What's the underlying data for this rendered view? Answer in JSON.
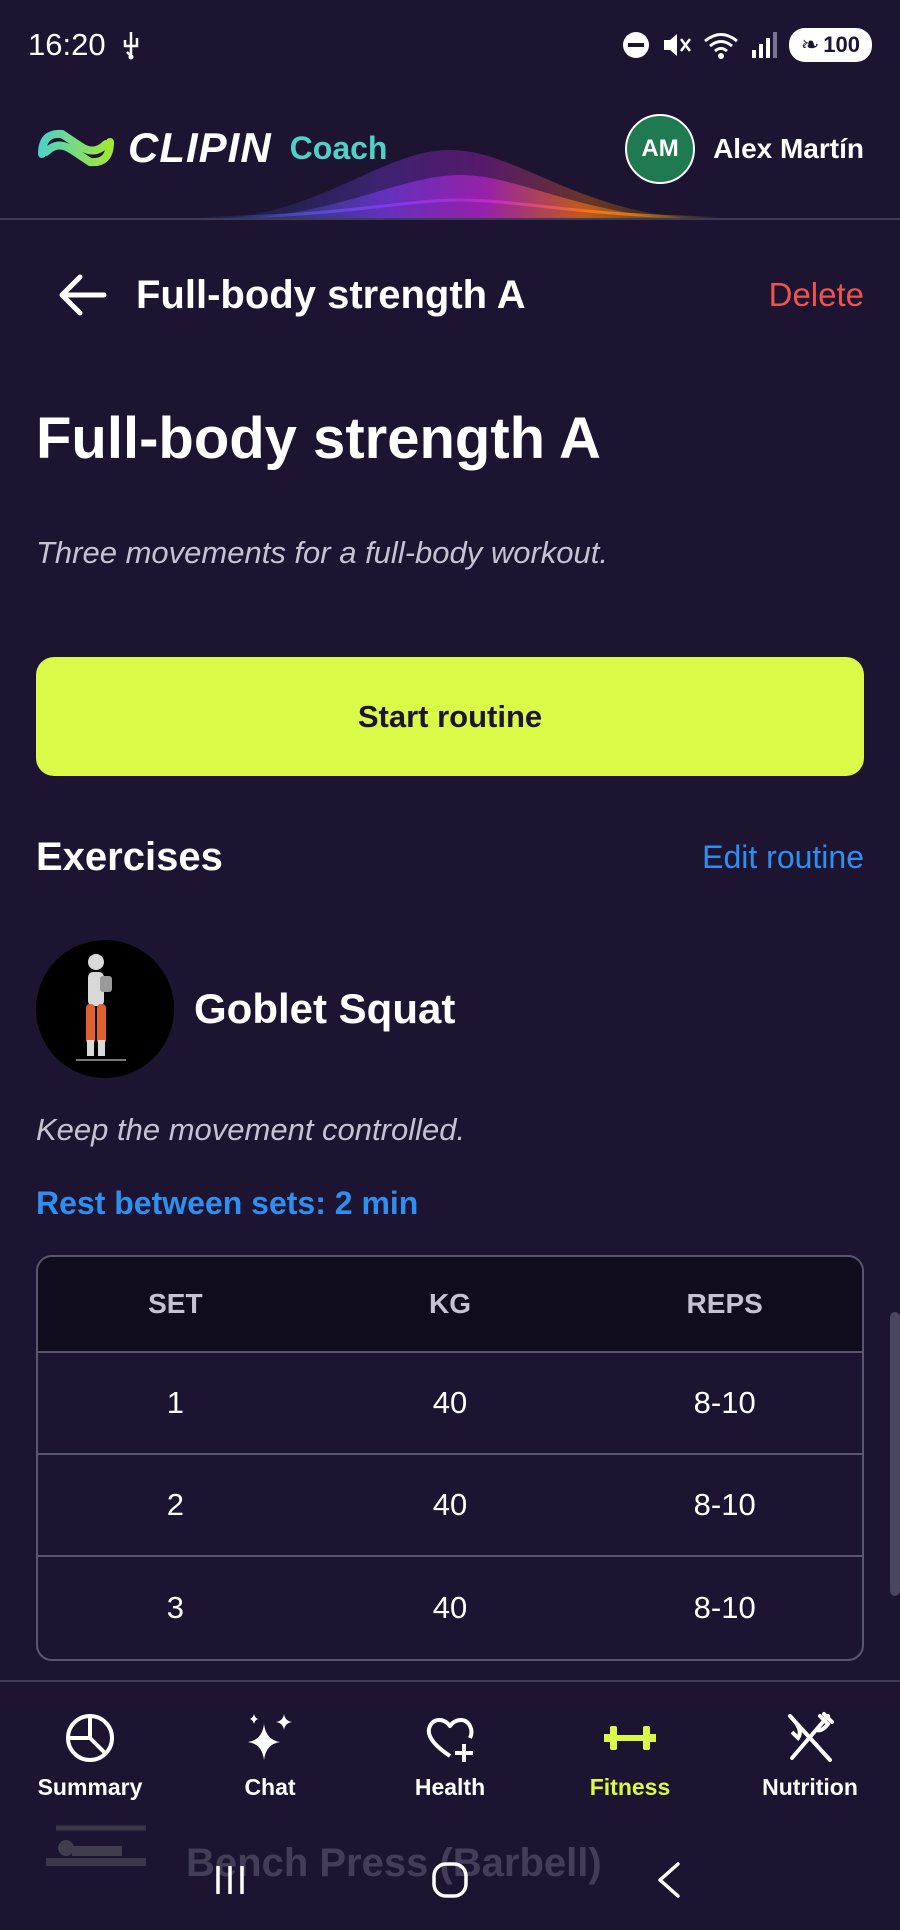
{
  "status_bar": {
    "time": "16:20",
    "battery": "100"
  },
  "header": {
    "brand": "CLIPIN",
    "product": "Coach",
    "user_initials": "AM",
    "user_name": "Alex Martín",
    "colors": {
      "brand_teal": "#4fd1c5",
      "avatar_bg": "#1f7a52"
    }
  },
  "nav": {
    "title": "Full-body strength A",
    "delete_label": "Delete"
  },
  "routine": {
    "title": "Full-body strength A",
    "description": "Three movements for a full-body workout.",
    "start_label": "Start routine"
  },
  "exercises_section": {
    "title": "Exercises",
    "edit_label": "Edit routine"
  },
  "exercise": {
    "name": "Goblet Squat",
    "note": "Keep the movement controlled.",
    "rest": "Rest between sets: 2 min",
    "columns": [
      "SET",
      "KG",
      "REPS"
    ],
    "sets": [
      {
        "set": "1",
        "kg": "40",
        "reps": "8-10"
      },
      {
        "set": "2",
        "kg": "40",
        "reps": "8-10"
      },
      {
        "set": "3",
        "kg": "40",
        "reps": "8-10"
      }
    ]
  },
  "next_exercise": {
    "name": "Bench Press (Barbell)"
  },
  "bottom_nav": [
    {
      "label": "Summary",
      "icon": "pie-chart-icon"
    },
    {
      "label": "Chat",
      "icon": "sparkles-icon"
    },
    {
      "label": "Health",
      "icon": "heart-plus-icon"
    },
    {
      "label": "Fitness",
      "icon": "dumbbell-icon",
      "active": true
    },
    {
      "label": "Nutrition",
      "icon": "fork-knife-icon"
    }
  ],
  "colors": {
    "background": "#1c1430",
    "accent": "#dbfa47",
    "link": "#2e8ff0",
    "danger": "#ef5350"
  }
}
